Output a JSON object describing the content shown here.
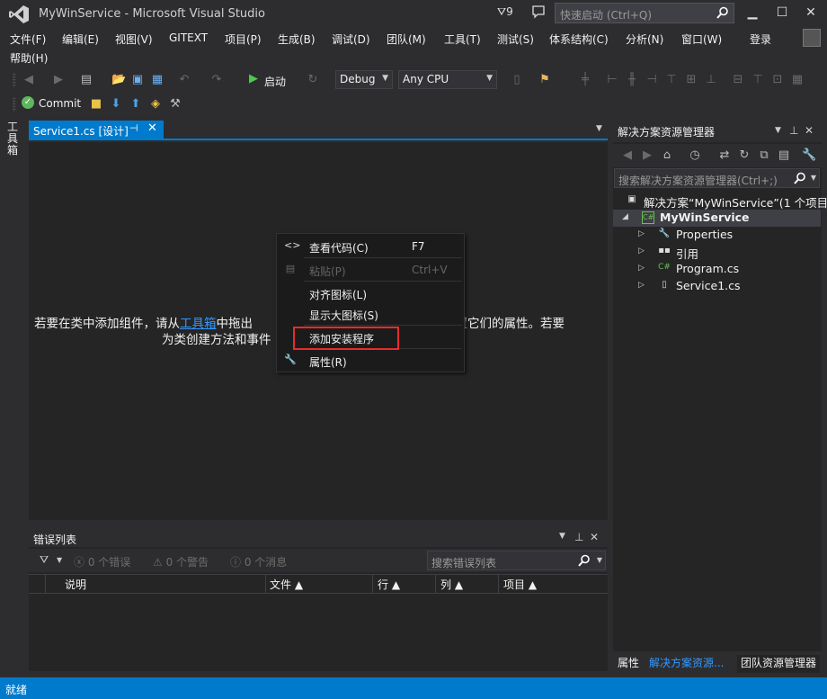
{
  "window": {
    "title": "MyWinService - Microsoft Visual Studio",
    "notification_count": "9",
    "quick_launch_placeholder": "快速启动 (Ctrl+Q)"
  },
  "menu": {
    "items": [
      "文件(F)",
      "编辑(E)",
      "视图(V)",
      "GITEXT",
      "项目(P)",
      "生成(B)",
      "调试(D)",
      "团队(M)",
      "工具(T)",
      "测试(S)",
      "体系结构(C)",
      "分析(N)",
      "窗口(W)"
    ],
    "help": "帮助(H)",
    "sign_in": "登录"
  },
  "toolbar": {
    "start_label": "启动",
    "configuration": "Debug",
    "platform": "Any CPU",
    "commit_label": "Commit"
  },
  "toolbox": {
    "label": "工具箱"
  },
  "document_tab": {
    "label": "Service1.cs [设计]"
  },
  "designer": {
    "message_line1_a": "若要在类中添加组件，请从",
    "message_link": "工具箱",
    "message_line1_b": "中拖出",
    "message_line1_c": "设置它们的属性。若要",
    "message_line2_a": "为类创建方法和事件",
    "message_line2_b": "。"
  },
  "context_menu": {
    "items": [
      {
        "label": "查看代码(C)",
        "shortcut": "F7",
        "icon": "code-icon",
        "enabled": true
      },
      {
        "label": "粘贴(P)",
        "shortcut": "Ctrl+V",
        "icon": "paste-icon",
        "enabled": false
      },
      {
        "label": "对齐图标(L)",
        "shortcut": "",
        "icon": "",
        "enabled": true
      },
      {
        "label": "显示大图标(S)",
        "shortcut": "",
        "icon": "",
        "enabled": true
      },
      {
        "label": "添加安装程序",
        "shortcut": "",
        "icon": "",
        "enabled": true
      },
      {
        "label": "属性(R)",
        "shortcut": "",
        "icon": "wrench-icon",
        "enabled": true
      }
    ]
  },
  "error_list": {
    "title": "错误列表",
    "errors": "0 个错误",
    "warnings": "0 个警告",
    "messages": "0 个消息",
    "search_placeholder": "搜索错误列表",
    "columns": [
      "说明",
      "文件",
      "行",
      "列",
      "项目"
    ]
  },
  "solution_explorer": {
    "title": "解决方案资源管理器",
    "search_placeholder": "搜索解决方案资源管理器(Ctrl+;)",
    "solution": "解决方案“MyWinService”(1 个项目)",
    "project": "MyWinService",
    "items": [
      "Properties",
      "引用",
      "Program.cs",
      "Service1.cs"
    ]
  },
  "panel_tabs": [
    "属性",
    "解决方案资源...",
    "团队资源管理器"
  ],
  "status": {
    "text": "就绪"
  },
  "colors": {
    "accent": "#007acc",
    "background": "#2d2d30",
    "highlight_box": "#e82b2b",
    "link": "#3399ff"
  }
}
